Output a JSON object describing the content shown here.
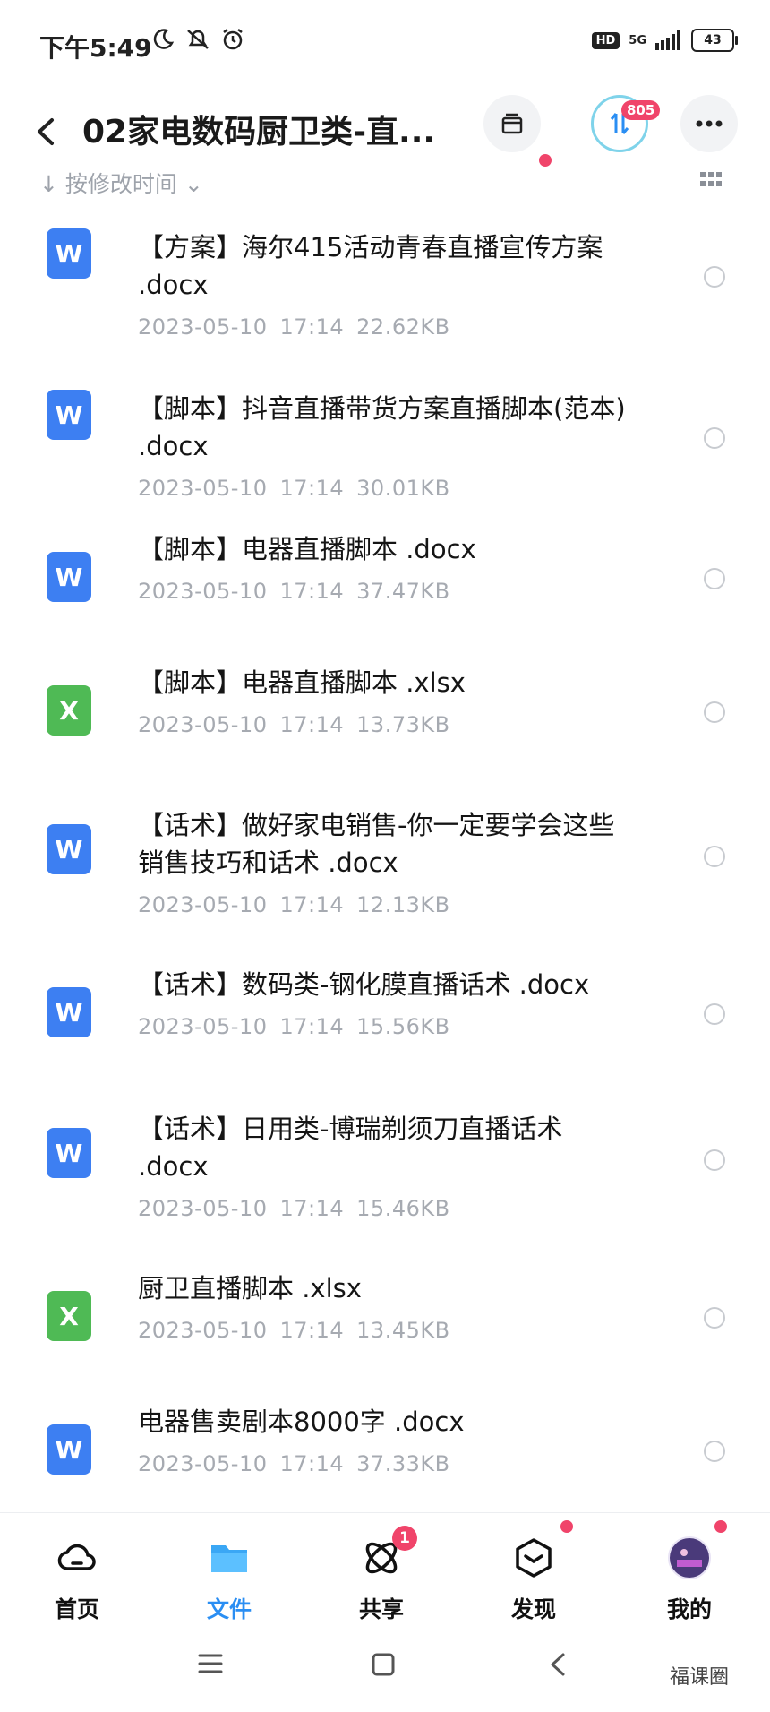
{
  "status": {
    "time": "下午5:49",
    "hd": "HD",
    "network": "5G",
    "battery": "43"
  },
  "header": {
    "title": "02家电数码厨卫类-直...",
    "transfer_count": "805"
  },
  "sort": {
    "label": "按修改时间"
  },
  "files": [
    {
      "type": "word",
      "icon_letter": "W",
      "name": "【方案】海尔415活动青春直播宣传方案 .docx",
      "date": "2023-05-10",
      "time": "17:14",
      "size": "22.62KB"
    },
    {
      "type": "word",
      "icon_letter": "W",
      "name": "【脚本】抖音直播带货方案直播脚本(范本) .docx",
      "date": "2023-05-10",
      "time": "17:14",
      "size": "30.01KB"
    },
    {
      "type": "word",
      "icon_letter": "W",
      "name": "【脚本】电器直播脚本 .docx",
      "date": "2023-05-10",
      "time": "17:14",
      "size": "37.47KB"
    },
    {
      "type": "excel",
      "icon_letter": "X",
      "name": "【脚本】电器直播脚本 .xlsx",
      "date": "2023-05-10",
      "time": "17:14",
      "size": "13.73KB"
    },
    {
      "type": "word",
      "icon_letter": "W",
      "name": "【话术】做好家电销售-你一定要学会这些销售技巧和话术 .docx",
      "date": "2023-05-10",
      "time": "17:14",
      "size": "12.13KB"
    },
    {
      "type": "word",
      "icon_letter": "W",
      "name": "【话术】数码类-钢化膜直播话术 .docx",
      "date": "2023-05-10",
      "time": "17:14",
      "size": "15.56KB"
    },
    {
      "type": "word",
      "icon_letter": "W",
      "name": "【话术】日用类-博瑞剃须刀直播话术 .docx",
      "date": "2023-05-10",
      "time": "17:14",
      "size": "15.46KB"
    },
    {
      "type": "excel",
      "icon_letter": "X",
      "name": "厨卫直播脚本 .xlsx",
      "date": "2023-05-10",
      "time": "17:14",
      "size": "13.45KB"
    },
    {
      "type": "word",
      "icon_letter": "W",
      "name": "电器售卖剧本8000字 .docx",
      "date": "2023-05-10",
      "time": "17:14",
      "size": "37.33KB"
    }
  ],
  "bottom_nav": {
    "items": [
      {
        "label": "首页",
        "icon": "cloud-icon"
      },
      {
        "label": "文件",
        "icon": "folder-icon"
      },
      {
        "label": "共享",
        "icon": "atom-icon",
        "badge": "1"
      },
      {
        "label": "发现",
        "icon": "cube-icon"
      },
      {
        "label": "我的",
        "icon": "avatar-icon"
      }
    ]
  },
  "watermark": "福课圈",
  "colors": {
    "accent": "#2a8ef3",
    "badge": "#f0446a",
    "word": "#3d7ff2",
    "excel": "#4fba55"
  }
}
